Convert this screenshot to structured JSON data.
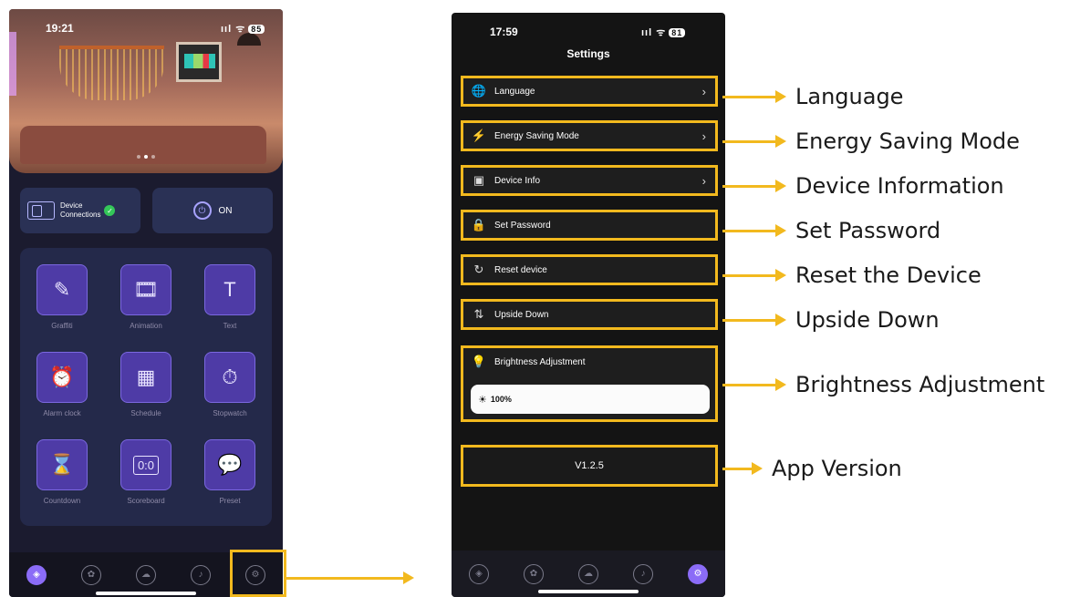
{
  "colors": {
    "highlight": "#f2b91e",
    "accent": "#8b6cf7",
    "connected": "#34c759"
  },
  "phone1": {
    "status": {
      "time": "19:21",
      "signal": "ııl ᯤ",
      "battery": "85"
    },
    "device_connections": "Device\nConnections",
    "power_label": "ON",
    "tiles": [
      {
        "label": "Graffiti",
        "icon": "palette-icon",
        "glyph": "✎"
      },
      {
        "label": "Animation",
        "icon": "film-icon",
        "glyph": "🎞"
      },
      {
        "label": "Text",
        "icon": "text-icon",
        "glyph": "T"
      },
      {
        "label": "Alarm clock",
        "icon": "alarm-icon",
        "glyph": "⏰"
      },
      {
        "label": "Schedule",
        "icon": "calendar-icon",
        "glyph": "▦"
      },
      {
        "label": "Stopwatch",
        "icon": "stopwatch-icon",
        "glyph": "⏱"
      },
      {
        "label": "Countdown",
        "icon": "hourglass-icon",
        "glyph": "⌛"
      },
      {
        "label": "Scoreboard",
        "icon": "scoreboard-icon",
        "glyph": "0:0"
      },
      {
        "label": "Preset",
        "icon": "chat-icon",
        "glyph": "💬"
      }
    ],
    "nav": [
      "compass-icon",
      "flower-icon",
      "cloud-icon",
      "music-icon",
      "gear-icon"
    ]
  },
  "phone2": {
    "status": {
      "time": "17:59",
      "signal": "ııl ᯤ",
      "battery": "81"
    },
    "title": "Settings",
    "rows": [
      {
        "label": "Language",
        "icon": "globe-icon",
        "glyph": "🌐",
        "chevron": "›"
      },
      {
        "label": "Energy Saving Mode",
        "icon": "energy-icon",
        "glyph": "⚡",
        "chevron": "›"
      },
      {
        "label": "Device Info",
        "icon": "device-info-icon",
        "glyph": "▣",
        "chevron": "›"
      },
      {
        "label": "Set Password",
        "icon": "lock-icon",
        "glyph": "🔒",
        "chevron": ""
      },
      {
        "label": "Reset device",
        "icon": "reset-icon",
        "glyph": "↻",
        "chevron": ""
      },
      {
        "label": "Upside Down",
        "icon": "flip-icon",
        "glyph": "⇅",
        "chevron": ""
      }
    ],
    "brightness": {
      "label": "Brightness Adjustment",
      "value": "100%",
      "level_percent": 100
    },
    "version": "V1.2.5",
    "nav": [
      "compass-icon",
      "flower-icon",
      "cloud-icon",
      "music-icon",
      "gear-icon"
    ]
  },
  "callouts": [
    "Language",
    "Energy Saving Mode",
    "Device Information",
    "Set Password",
    "Reset the Device",
    "Upside Down",
    "Brightness Adjustment",
    "App Version"
  ]
}
